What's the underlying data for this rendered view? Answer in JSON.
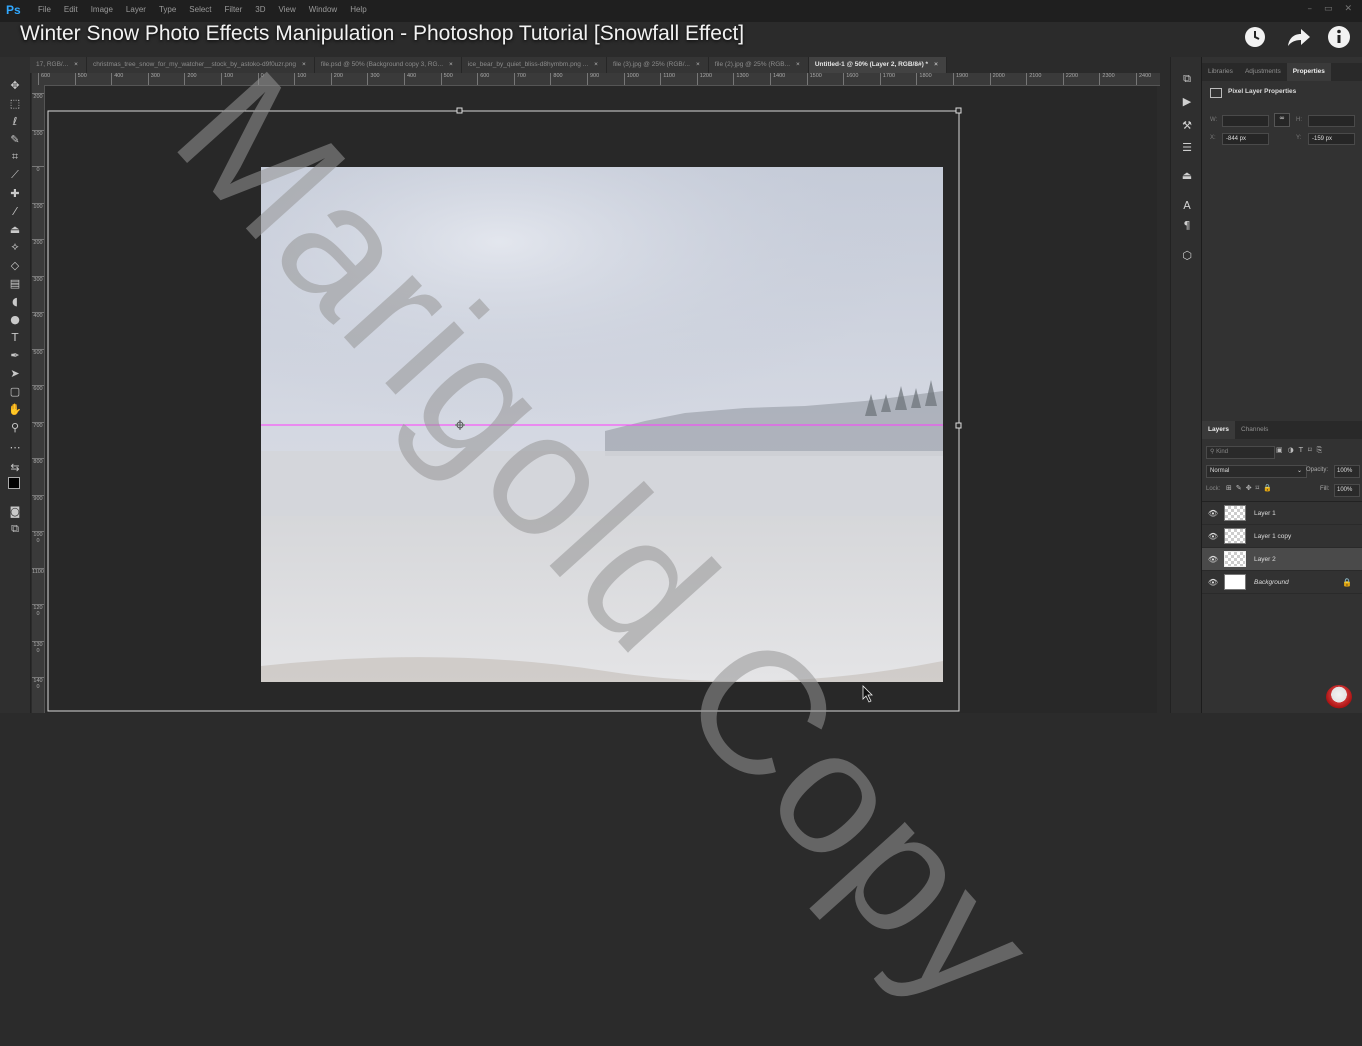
{
  "video": {
    "title": "Winter Snow Photo Effects Manipulation - Photoshop Tutorial [Snowfall Effect]",
    "watermark": "Marigold Copy",
    "icons": [
      "clock-icon",
      "share-icon",
      "info-icon"
    ]
  },
  "app": {
    "logo": "Ps",
    "menu": [
      "File",
      "Edit",
      "Image",
      "Layer",
      "Type",
      "Select",
      "Filter",
      "3D",
      "View",
      "Window",
      "Help"
    ]
  },
  "tabs": [
    {
      "label": "17, RGB/...",
      "active": false
    },
    {
      "label": "christmas_tree_snow_for_my_watcher__stock_by_astoko-d9f0uzr.png",
      "active": false
    },
    {
      "label": "file.psd @ 50% (Background copy 3, RG...",
      "active": false
    },
    {
      "label": "ice_bear_by_quiet_bliss-d8hymbm.png ...",
      "active": false
    },
    {
      "label": "file (3).jpg @ 25% (RGB/...",
      "active": false
    },
    {
      "label": "file (2).jpg @ 25% (RGB...",
      "active": false
    },
    {
      "label": "Untitled-1 @ 50% (Layer 2, RGB/8#) *",
      "active": true
    }
  ],
  "ruler": {
    "top": [
      "600",
      "500",
      "400",
      "300",
      "200",
      "100",
      "0",
      "100",
      "200",
      "300",
      "400",
      "500",
      "600",
      "700",
      "800",
      "900",
      "1000",
      "1100",
      "1200",
      "1300",
      "1400",
      "1500",
      "1600",
      "1700",
      "1800",
      "1900",
      "2000",
      "2100",
      "2200",
      "2300",
      "2400"
    ],
    "left": [
      "200",
      "100",
      "0",
      "100",
      "200",
      "300",
      "400",
      "500",
      "600",
      "700",
      "800",
      "900",
      "1000",
      "1100",
      "1200",
      "1300",
      "1400",
      "1500"
    ]
  },
  "properties": {
    "tabs": [
      "Libraries",
      "Adjustments",
      "Properties"
    ],
    "active_tab": "Properties",
    "heading": "Pixel Layer Properties",
    "w_label": "W:",
    "h_label": "H:",
    "w_value": "",
    "h_value": "",
    "x_label": "X:",
    "x_value": "-844 px",
    "y_label": "Y:",
    "y_value": "-159 px"
  },
  "layers_panel": {
    "tabs": [
      "Layers",
      "Channels"
    ],
    "active_tab": "Layers",
    "search_placeholder": "Kind",
    "blend_mode": "Normal",
    "opacity_label": "Opacity:",
    "opacity_value": "100%",
    "lock_label": "Lock:",
    "fill_label": "Fill:",
    "fill_value": "100%",
    "layers": [
      {
        "name": "Layer 1",
        "thumb": "checker",
        "selected": false,
        "italic": false,
        "locked": false
      },
      {
        "name": "Layer 1 copy",
        "thumb": "checker",
        "selected": false,
        "italic": false,
        "locked": false
      },
      {
        "name": "Layer 2",
        "thumb": "checker",
        "selected": true,
        "italic": false,
        "locked": false
      },
      {
        "name": "Background",
        "thumb": "white",
        "selected": false,
        "italic": true,
        "locked": true
      }
    ]
  },
  "colors": {
    "accent": "#31a8ff",
    "guide": "#ff3cff",
    "selection_layer": "#4a4a4a"
  }
}
